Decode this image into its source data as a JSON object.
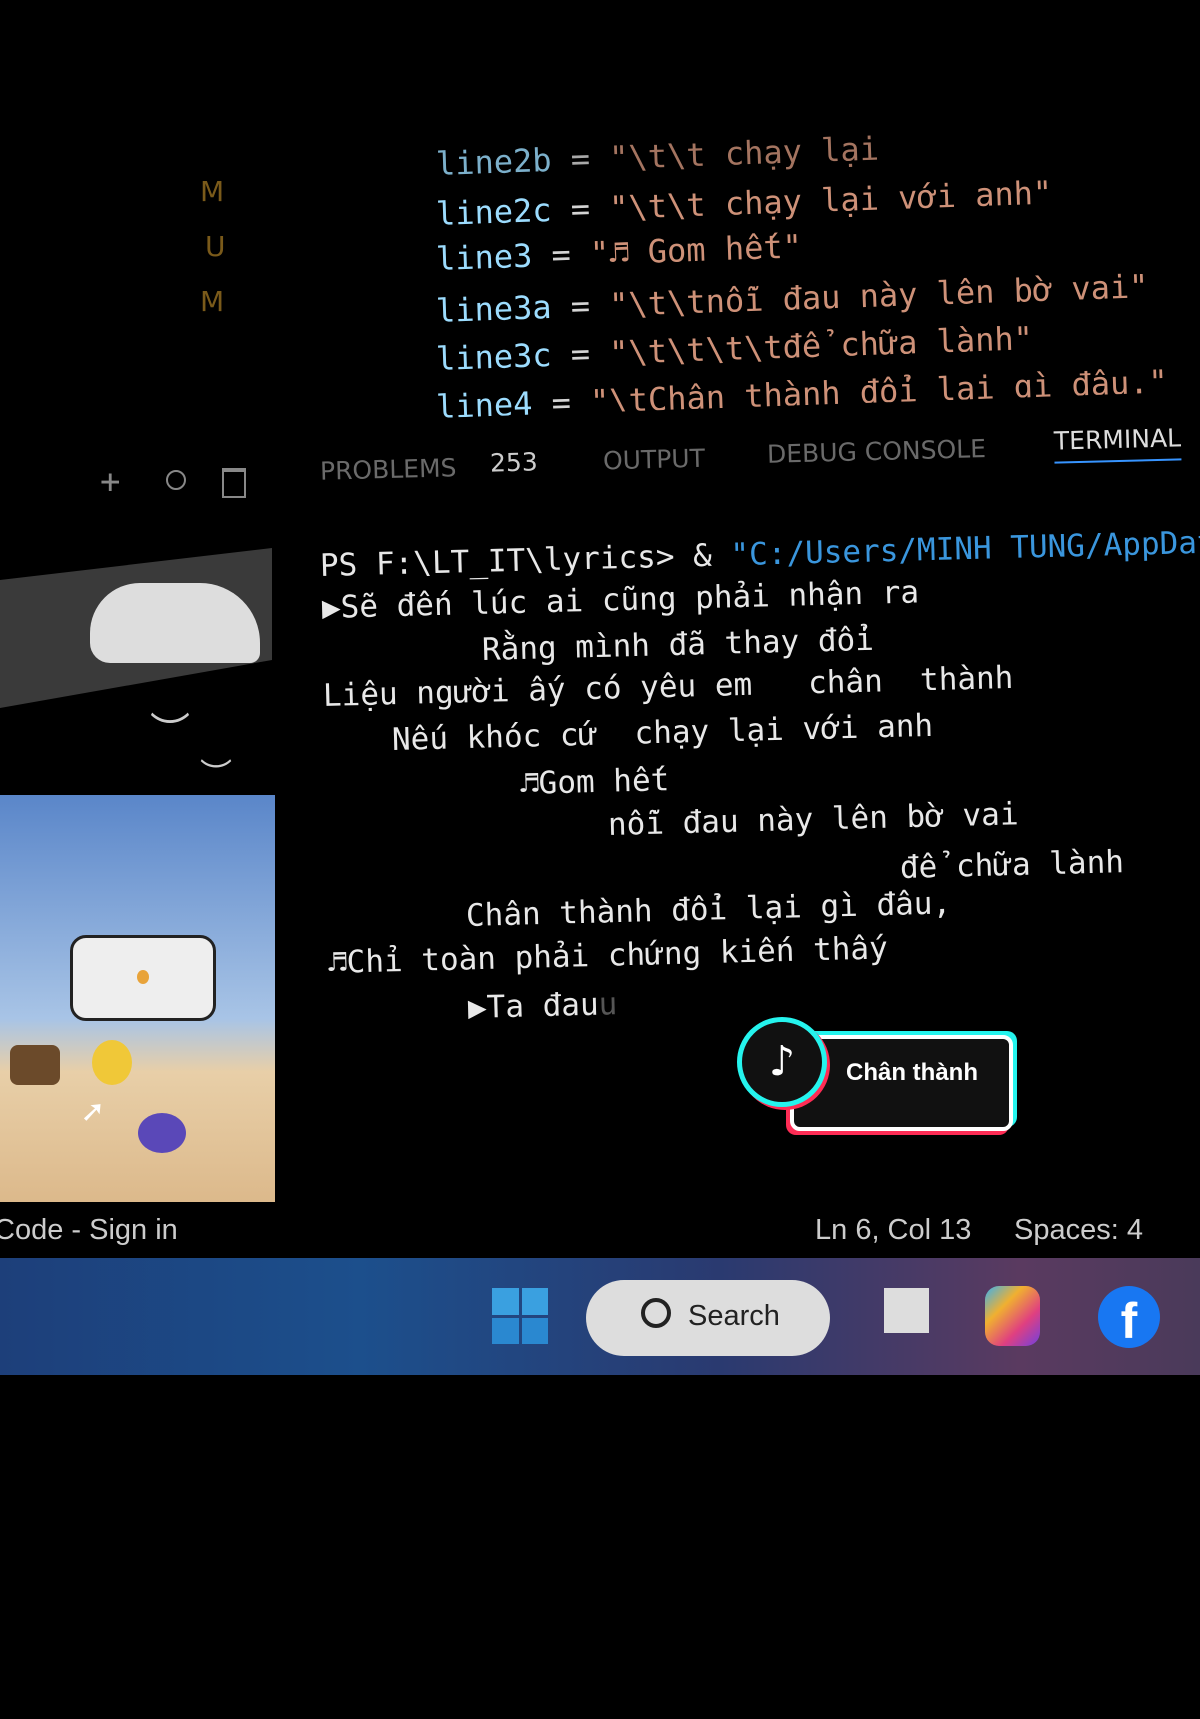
{
  "editor": {
    "gutter_markers": [
      "M",
      "U",
      "M"
    ],
    "lines": [
      {
        "name": "line2b",
        "value": "\"\\t\\t chạy lại"
      },
      {
        "name": "line2c",
        "value": "\"\\t\\t chạy lại với anh\""
      },
      {
        "name": "line3",
        "value": "\"♬ Gom hết\""
      },
      {
        "name": "line3a",
        "value": "\"\\t\\tnỗi đau này lên bờ vai\""
      },
      {
        "name": "line3c",
        "value": "\"\\t\\t\\t\\tđể chữa lành\""
      },
      {
        "name": "line4",
        "value": "\"\\tChân thành đổi lại gì đâu.\""
      }
    ],
    "eq": "="
  },
  "panel": {
    "tabs": {
      "problems": "PROBLEMS",
      "problems_count": "253",
      "output": "OUTPUT",
      "debug": "DEBUG CONSOLE",
      "terminal": "TERMINAL"
    },
    "icons": [
      "plus-icon",
      "circle-icon",
      "trash-icon"
    ]
  },
  "terminal": {
    "prompt": "PS F:\\LT_IT\\lyrics> & ",
    "command": "\"C:/Users/MINH TUNG/AppDat",
    "lines": [
      "▶Sẽ đến lúc ai cũng phải nhận ra",
      "Rằng mình đã thay đổi",
      "Liệu người ấy có yêu em   chân  thành",
      "Nếu khóc cứ  chạy lại với anh",
      "♬Gom hết",
      "nỗi đau này lên bờ vai",
      "để chữa lành",
      "Chân thành đổi lại gì đâu,",
      "♬Chỉ toàn phải chứng kiến thấy",
      "▶Ta đau"
    ],
    "cursor_char": "u"
  },
  "tiktok": {
    "label": "Chân thành"
  },
  "statusbar": {
    "left": "Code - Sign in",
    "position": "Ln 6, Col 13",
    "spaces": "Spaces: 4"
  },
  "taskbar": {
    "search": "Search",
    "icons": [
      "windows-start-icon",
      "task-view-icon",
      "copilot-icon",
      "facebook-icon"
    ]
  }
}
